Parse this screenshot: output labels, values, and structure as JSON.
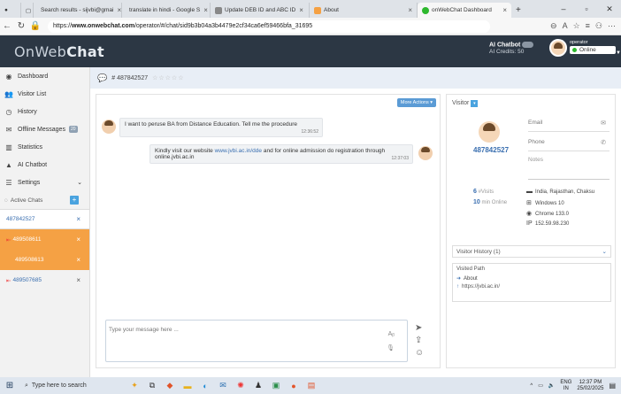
{
  "browser": {
    "tabs": [
      {
        "label": "Search results - sijvbi@gmai",
        "fav_color": "#c84b3a"
      },
      {
        "label": "translate in hindi - Google S",
        "fav_color": "#4285f4"
      },
      {
        "label": "Update DEB ID and ABC ID",
        "fav_color": "#888888"
      },
      {
        "label": "About",
        "fav_color": "#f5a144"
      },
      {
        "label": "onWebChat Dashboard",
        "fav_color": "#2eb82e"
      }
    ],
    "url_prefix": "https://",
    "url_host": "www.onwebchat.com",
    "url_path": "/operator/#/chat/sid9b3b04a3b4479e2cf34ca6ef59466bfa_31695"
  },
  "app": {
    "logo_light": "OnWeb",
    "logo_bold": "Chat",
    "ai_chatbot_label": "AI Chatbot",
    "ai_credits": "AI Credits: 50",
    "operator_label": "operator",
    "status": "Online"
  },
  "sidebar": {
    "items": [
      {
        "label": "Dashboard"
      },
      {
        "label": "Visitor List"
      },
      {
        "label": "History"
      },
      {
        "label": "Offline Messages",
        "badge": "20"
      },
      {
        "label": "Statistics"
      },
      {
        "label": "AI Chatbot"
      },
      {
        "label": "Settings"
      }
    ],
    "active_chats_label": "Active Chats",
    "chats": [
      {
        "id": "487842527"
      },
      {
        "id": "489508611"
      },
      {
        "id": "489508613"
      },
      {
        "id": "489507685"
      }
    ]
  },
  "chat": {
    "visitor_id": "487842527",
    "more_actions": "More Actions",
    "messages": [
      {
        "text": "I want to peruse BA from Distance Education. Tell me the procedure",
        "time": "12:36:52"
      },
      {
        "text_before": "Kindly visit our website ",
        "link": "www.jvbi.ac.in/dde",
        "text_after": " and for online admission do registration through online.jvbi.ac.in",
        "time": "12:37:03"
      }
    ],
    "input_placeholder": "Type your message here ..."
  },
  "visitor": {
    "title": "Visitor",
    "id": "487842527",
    "email_placeholder": "Email",
    "phone_placeholder": "Phone",
    "notes_placeholder": "Notes",
    "visits_count": "6",
    "visits_label": "#Visits",
    "online_minutes": "10",
    "online_label": "min Online",
    "location": "India, Rajasthan, Chaksu",
    "os": "Windows 10",
    "browser": "Chrome 133.0",
    "ip_label": "IP",
    "ip": "152.59.98.230",
    "history_label": "Visitor History (1)",
    "visited_path_label": "Visited Path",
    "path_items": [
      "About",
      "https://jvbi.ac.in/"
    ]
  },
  "taskbar": {
    "search_placeholder": "Type here to search",
    "lang": "ENG",
    "region": "IN",
    "time": "12:37 PM",
    "date": "25/02/2025"
  }
}
